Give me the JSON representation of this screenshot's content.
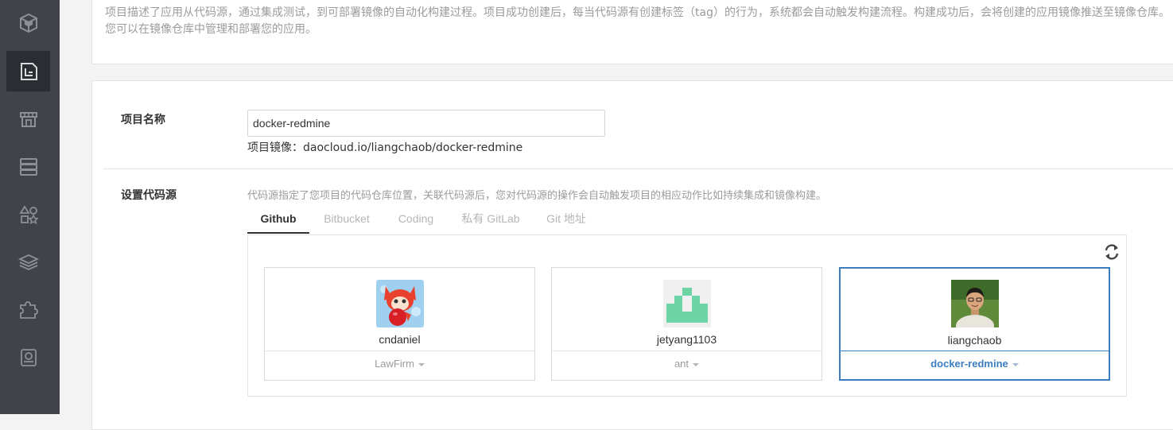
{
  "sidebar": {
    "items": [
      {
        "icon": "cube-logo-icon",
        "active": false
      },
      {
        "icon": "project-icon",
        "active": true
      },
      {
        "icon": "store-icon",
        "active": false
      },
      {
        "icon": "server-icon",
        "active": false
      },
      {
        "icon": "shapes-icon",
        "active": false
      },
      {
        "icon": "layers-icon",
        "active": false
      },
      {
        "icon": "puzzle-icon",
        "active": false
      },
      {
        "icon": "hdd-icon",
        "active": false
      }
    ]
  },
  "intro": {
    "description": "项目描述了应用从代码源，通过集成测试，到可部署镜像的自动化构建过程。项目成功创建后，每当代码源有创建标签（tag）的行为，系统都会自动触发构建流程。构建成功后，会将创建的应用镜像推送至镜像仓库。您可以在镜像仓库中管理和部署您的应用。"
  },
  "form": {
    "project_name_label": "项目名称",
    "project_name_value": "docker-redmine",
    "image_label": "项目镜像：",
    "image_value": "daocloud.io/liangchaob/docker-redmine",
    "source_label": "设置代码源",
    "source_hint": "代码源指定了您项目的代码仓库位置，关联代码源后，您对代码源的操作会自动触发项目的相应动作比如持续集成和镜像构建。"
  },
  "tabs": [
    {
      "label": "Github",
      "active": true
    },
    {
      "label": "Bitbucket",
      "active": false
    },
    {
      "label": "Coding",
      "active": false
    },
    {
      "label": "私有 GitLab",
      "active": false
    },
    {
      "label": "Git 地址",
      "active": false
    }
  ],
  "accounts": [
    {
      "name": "cndaniel",
      "org": "LawFirm",
      "selected": false,
      "avatar": "fox-avatar"
    },
    {
      "name": "jetyang1103",
      "org": "ant",
      "selected": false,
      "avatar": "identicon-avatar"
    },
    {
      "name": "liangchaob",
      "org": "docker-redmine",
      "selected": true,
      "avatar": "photo-avatar"
    }
  ],
  "colors": {
    "sidebar": "#40434a",
    "sidebar_active": "#2b2d32",
    "accent": "#3b7ec0",
    "muted": "#9b9b9b",
    "identicon": "#6fd3a8"
  }
}
